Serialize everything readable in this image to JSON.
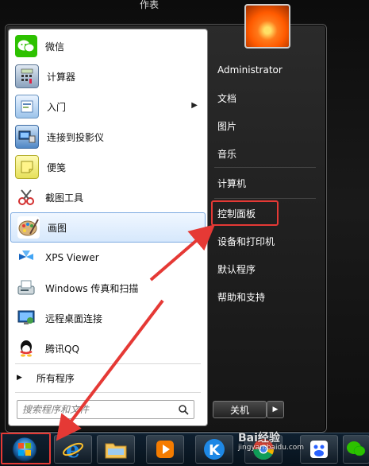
{
  "top_title": "作表",
  "start_menu": {
    "programs": [
      {
        "label": "微信",
        "icon": "wechat-icon",
        "has_submenu": false
      },
      {
        "label": "计算器",
        "icon": "calculator-icon",
        "has_submenu": false
      },
      {
        "label": "入门",
        "icon": "getting-started-icon",
        "has_submenu": true
      },
      {
        "label": "连接到投影仪",
        "icon": "projector-icon",
        "has_submenu": false
      },
      {
        "label": "便笺",
        "icon": "sticky-notes-icon",
        "has_submenu": false
      },
      {
        "label": "截图工具",
        "icon": "snipping-tool-icon",
        "has_submenu": false
      },
      {
        "label": "画图",
        "icon": "paint-icon",
        "has_submenu": false,
        "selected": true
      },
      {
        "label": "XPS Viewer",
        "icon": "xps-viewer-icon",
        "has_submenu": false
      },
      {
        "label": "Windows 传真和扫描",
        "icon": "fax-scan-icon",
        "has_submenu": false
      },
      {
        "label": "远程桌面连接",
        "icon": "remote-desktop-icon",
        "has_submenu": false
      },
      {
        "label": "腾讯QQ",
        "icon": "qq-icon",
        "has_submenu": false
      }
    ],
    "all_programs_label": "所有程序",
    "search_placeholder": "搜索程序和文件",
    "right_items": {
      "user": "Administrator",
      "documents": "文档",
      "pictures": "图片",
      "music": "音乐",
      "computer": "计算机",
      "control_panel": "控制面板",
      "devices_printers": "设备和打印机",
      "default_programs": "默认程序",
      "help_support": "帮助和支持"
    },
    "shutdown_label": "关机"
  },
  "taskbar": {
    "apps": [
      "internet-explorer-icon",
      "file-explorer-icon",
      "media-player-icon",
      "kugou-icon",
      "chrome-icon",
      "baidu-icon",
      "wechat-icon"
    ]
  },
  "watermark": {
    "brand": "Bai经验",
    "url": "jingyan.baidu.com"
  },
  "colors": {
    "annotation_red": "#e53935",
    "selected_bg": "#d6e8fc",
    "taskbar_bg": "#0f2030"
  }
}
